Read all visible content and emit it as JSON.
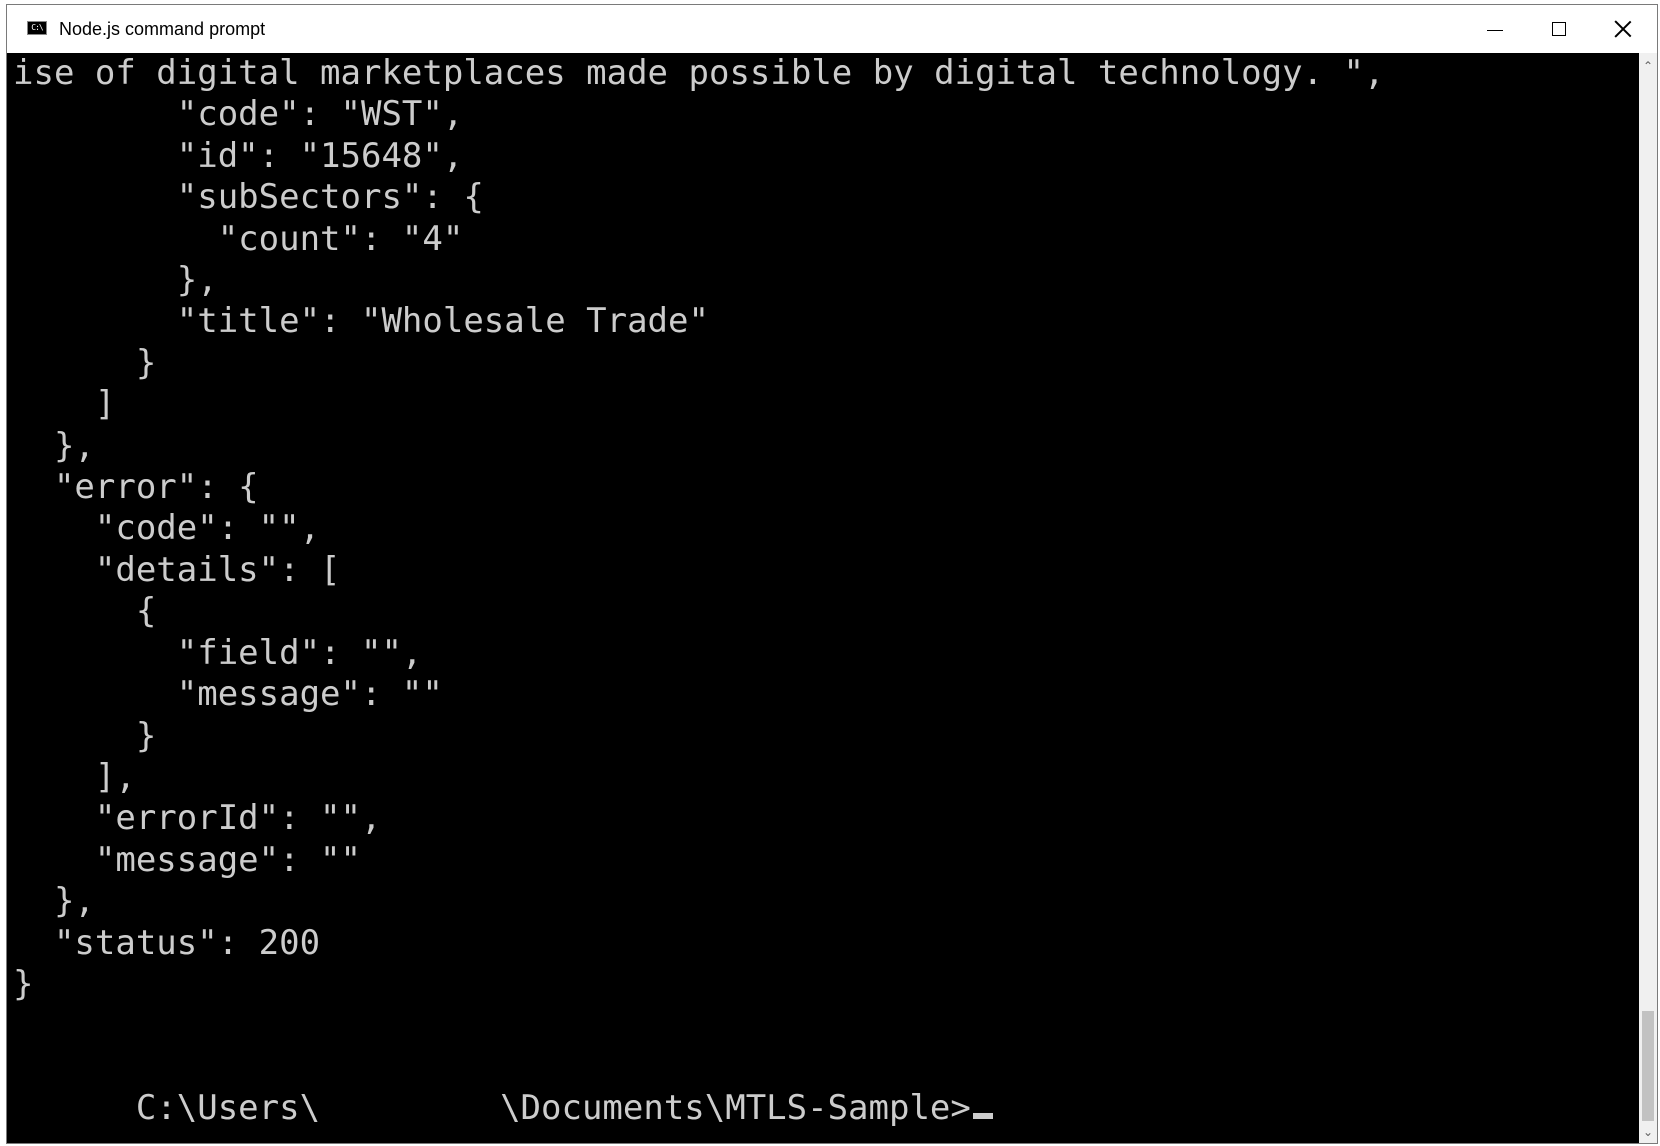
{
  "window": {
    "title": "Node.js command prompt",
    "icon_label": "C:\\",
    "controls": {
      "minimize": "minimize-icon",
      "maximize": "maximize-icon",
      "close": "close-icon"
    }
  },
  "console": {
    "background": "#000000",
    "foreground": "#cccccc",
    "lines": [
      "ise of digital marketplaces made possible by digital technology. \",",
      "        \"code\": \"WST\",",
      "        \"id\": \"15648\",",
      "        \"subSectors\": {",
      "          \"count\": \"4\"",
      "        },",
      "        \"title\": \"Wholesale Trade\"",
      "      }",
      "    ]",
      "  },",
      "  \"error\": {",
      "    \"code\": \"\",",
      "    \"details\": [",
      "      {",
      "        \"field\": \"\",",
      "        \"message\": \"\"",
      "      }",
      "    ],",
      "    \"errorId\": \"\",",
      "    \"message\": \"\"",
      "  },",
      "  \"status\": 200",
      "}",
      ""
    ],
    "prompt_prefix": "C:\\Users\\",
    "prompt_suffix": "\\Documents\\MTLS-Sample>"
  },
  "scrollbar": {
    "up_icon": "chevron-up-icon",
    "down_icon": "chevron-down-icon"
  }
}
